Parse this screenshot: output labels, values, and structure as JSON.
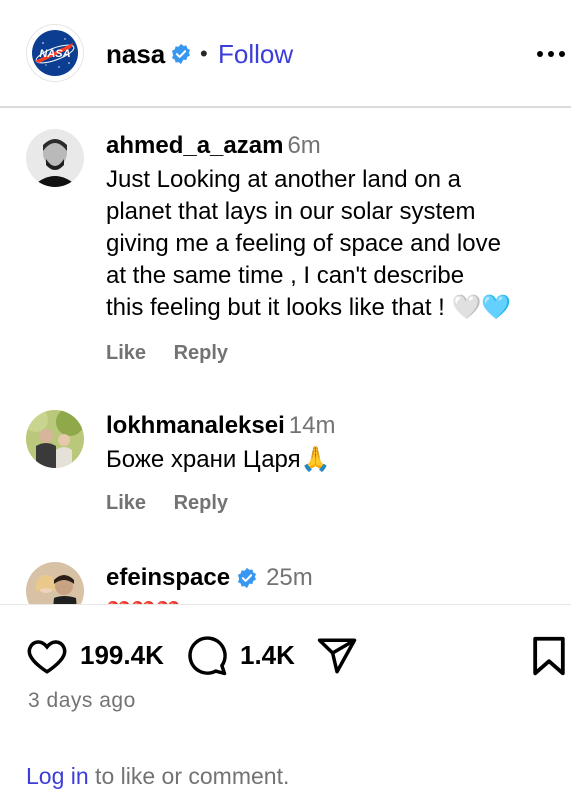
{
  "header": {
    "account_name": "nasa",
    "separator": "•",
    "follow_label": "Follow"
  },
  "comments": [
    {
      "username": "ahmed_a_azam",
      "time": "6m",
      "lines": [
        "Just Looking at another land on a",
        "planet that lays in our solar system",
        "giving me a feeling of space and love",
        "at the same time , I can't describe",
        "this feeling but it looks like that ! 🤍🩵"
      ],
      "like_label": "Like",
      "reply_label": "Reply"
    },
    {
      "username": "lokhmanaleksei",
      "time": "14m",
      "lines": [
        "Боже храни Царя🙏"
      ],
      "like_label": "Like",
      "reply_label": "Reply"
    },
    {
      "username": "efeinspace",
      "time": "25m",
      "verified": true,
      "lines": [
        "❤️❤️❤️"
      ]
    }
  ],
  "footer": {
    "likes": "199.4K",
    "comments": "1.4K",
    "time_ago": "3 days ago",
    "login_link": "Log in",
    "login_rest": " to like or comment."
  },
  "colors": {
    "accent": "#3b3ed9",
    "verified": "#3897f0",
    "muted": "#737373",
    "divider": "#dbdbdb"
  },
  "icons": [
    "nasa-logo",
    "verified-icon",
    "more-icon",
    "heart-icon",
    "comment-icon",
    "share-icon",
    "save-icon"
  ]
}
